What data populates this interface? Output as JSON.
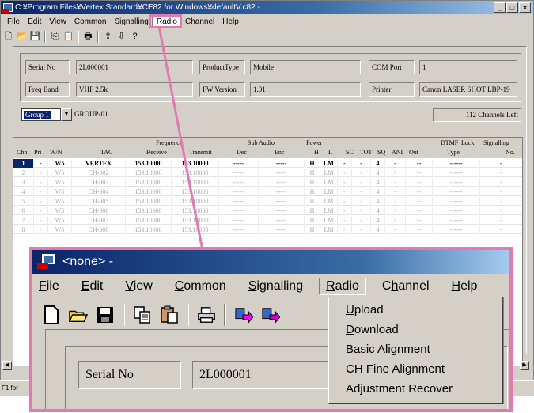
{
  "window": {
    "title": "C:¥Program Files¥Vertex Standard¥CE82 for Windows¥defaultV.c82 -",
    "controls": [
      "_",
      "□",
      "×"
    ]
  },
  "menu": [
    {
      "label": "File",
      "key": "F"
    },
    {
      "label": "Edit",
      "key": "E"
    },
    {
      "label": "View",
      "key": "V"
    },
    {
      "label": "Common",
      "key": "C"
    },
    {
      "label": "Signalling",
      "key": "S"
    },
    {
      "label": "Radio",
      "key": "R"
    },
    {
      "label": "Channel",
      "key": "h"
    },
    {
      "label": "Help",
      "key": "H"
    }
  ],
  "info": {
    "serial_label": "Serial No",
    "serial_value": "2L000001",
    "product_label": "ProductType",
    "product_value": "Mobile",
    "com_label": "COM Port",
    "com_value": "1",
    "band_label": "Freq Band",
    "band_value": "VHF 2.5k",
    "fw_label": "FW Version",
    "fw_value": "1.01",
    "printer_label": "Printer",
    "printer_value": "Canon LASER SHOT LBP-19"
  },
  "group": {
    "selected": "Group 1",
    "name": "GROUP-01",
    "channels_left": "112 Channels Left"
  },
  "table": {
    "group_headers": [
      "Frequency",
      "Sub Audio",
      "Power",
      "DTMF",
      "Lock",
      "Signalling"
    ],
    "headers": [
      "Chn",
      "Pri",
      "W/N",
      "TAG",
      "Receive",
      "Transmit",
      "Dec",
      "Enc",
      "H",
      "L",
      "SC",
      "TOT",
      "SQ",
      "ANI",
      "Out",
      "Type",
      "No."
    ],
    "rows": [
      [
        "1",
        "-",
        "W5",
        "VERTEX",
        "153.10000",
        "153.10000",
        "-----",
        "-----",
        "H",
        "LM",
        "-",
        "-",
        "4",
        "-",
        "--",
        "------",
        "-"
      ],
      [
        "2",
        "-",
        "W5",
        "CH-002",
        "153.10000",
        "153.10000",
        "-----",
        "-----",
        "H",
        "LM",
        "-",
        "-",
        "4",
        "-",
        "--",
        "------",
        "-"
      ],
      [
        "3",
        "-",
        "W5",
        "CH-003",
        "153.10000",
        "153.10000",
        "-----",
        "-----",
        "H",
        "LM",
        "-",
        "-",
        "4",
        "-",
        "--",
        "------",
        "-"
      ],
      [
        "4",
        "-",
        "W5",
        "CH-004",
        "153.10000",
        "153.10000",
        "-----",
        "-----",
        "H",
        "LM",
        "-",
        "-",
        "4",
        "-",
        "--",
        "------",
        "-"
      ],
      [
        "5",
        "-",
        "W5",
        "CH-005",
        "153.10000",
        "153.10000",
        "-----",
        "-----",
        "H",
        "LM",
        "-",
        "-",
        "4",
        "-",
        "--",
        "------",
        "-"
      ],
      [
        "6",
        "-",
        "W5",
        "CH-006",
        "153.10000",
        "153.10000",
        "-----",
        "-----",
        "H",
        "LM",
        "-",
        "-",
        "4",
        "-",
        "--",
        "------",
        "-"
      ],
      [
        "7",
        "-",
        "W5",
        "CH-007",
        "153.10000",
        "153.10000",
        "-----",
        "-----",
        "H",
        "LM",
        "-",
        "-",
        "4",
        "-",
        "--",
        "------",
        "-"
      ],
      [
        "8",
        "-",
        "W5",
        "CH-008",
        "153.10000",
        "153.10000",
        "-----",
        "-----",
        "H",
        "LM",
        "-",
        "-",
        "4",
        "-",
        "--",
        "------",
        "-"
      ]
    ]
  },
  "status": "F1 for",
  "zoom": {
    "title": "<none> -",
    "serial_label": "Serial No",
    "serial_value": "2L000001"
  },
  "radio_menu": [
    {
      "label": "Upload",
      "key": "U"
    },
    {
      "label": "Download",
      "key": "D"
    },
    {
      "label": "Basic Alignment",
      "key": "A"
    },
    {
      "label": "CH Fine Alignment",
      "key": ""
    },
    {
      "label": "Adjustment Recover",
      "key": ""
    }
  ],
  "colors": {
    "highlight": "#e07ab0",
    "titlebar": "#0a246a",
    "selection": "#0a246a"
  }
}
